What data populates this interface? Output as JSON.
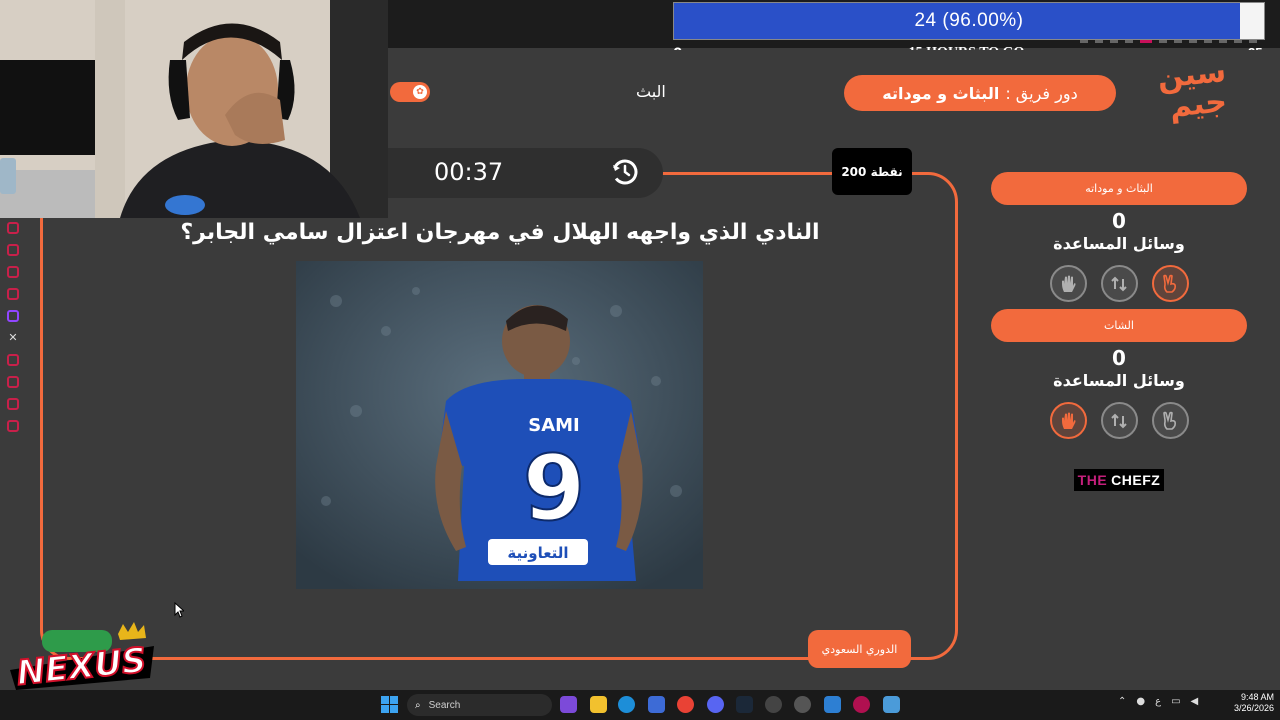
{
  "goal": {
    "text": "24  (96.00%)",
    "progress": 0.96,
    "min": "0",
    "time": "-15 HOURS TO GO",
    "max": "25"
  },
  "header": {
    "stream_label": "البث",
    "turn_prefix": "دور فريق :",
    "turn_team": "البثاث و موداته",
    "logo_text": "سين جيم"
  },
  "question": {
    "timer": "00:37",
    "points": "200 نقطة",
    "text": "النادي الذي واجهه الهلال في مهرجان اعتزال سامي الجابر؟",
    "category": "الدوري السعودي",
    "photo_jersey_name": "SAMI",
    "photo_jersey_number": "9",
    "photo_sponsor": "التعاونية"
  },
  "teams": [
    {
      "name": "البثاث و موداته",
      "score": "0",
      "helpers_label": "وسائل المساعدة",
      "helpers": [
        "hand-icon",
        "swap-icon",
        "peace-icon"
      ],
      "active": 2
    },
    {
      "name": "الشات",
      "score": "0",
      "helpers_label": "وسائل المساعدة",
      "helpers": [
        "hand-icon",
        "swap-icon",
        "peace-icon"
      ],
      "active": 0
    }
  ],
  "sponsor": {
    "prefix": "THE",
    "name": "CHEFZ"
  },
  "overlay": {
    "nexus": "NEXUS"
  },
  "taskbar": {
    "search_placeholder": "Search",
    "time": "9:48 AM",
    "date": "3/26/2026",
    "lang": "ع"
  },
  "colors": {
    "accent": "#f26a3d",
    "bg": "#3b3b3b",
    "goal_fill": "#2a50c8"
  }
}
